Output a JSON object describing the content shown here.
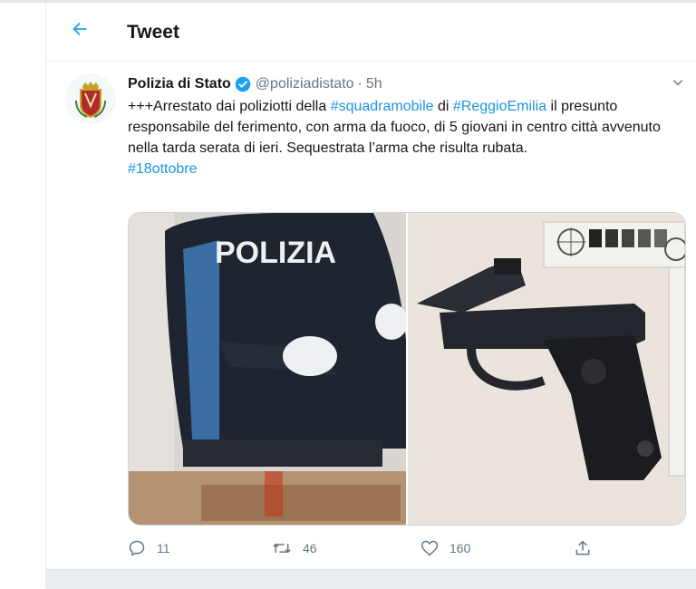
{
  "header": {
    "title": "Tweet"
  },
  "tweet": {
    "display_name": "Polizia di Stato",
    "handle": "@poliziadistato",
    "separator": "·",
    "time": "5h",
    "text_parts": {
      "p1": "+++Arrestato dai poliziotti della ",
      "hashtag1": "#squadramobile",
      "p2": " di ",
      "hashtag2": "#ReggioEmilia",
      "p3": " il presunto responsabile del ferimento, con arma da fuoco, di 5 giovani in centro città avvenuto nella tarda serata di ieri. Sequestrata l’arma che risulta rubata.",
      "hashtag3": "#18ottobre"
    },
    "media": {
      "left_vest_text": "POLIZIA"
    },
    "actions": {
      "replies": "11",
      "retweets": "46",
      "likes": "160"
    }
  },
  "colors": {
    "accent": "#1da1f2",
    "link": "#1b95e0",
    "muted": "#657786"
  }
}
